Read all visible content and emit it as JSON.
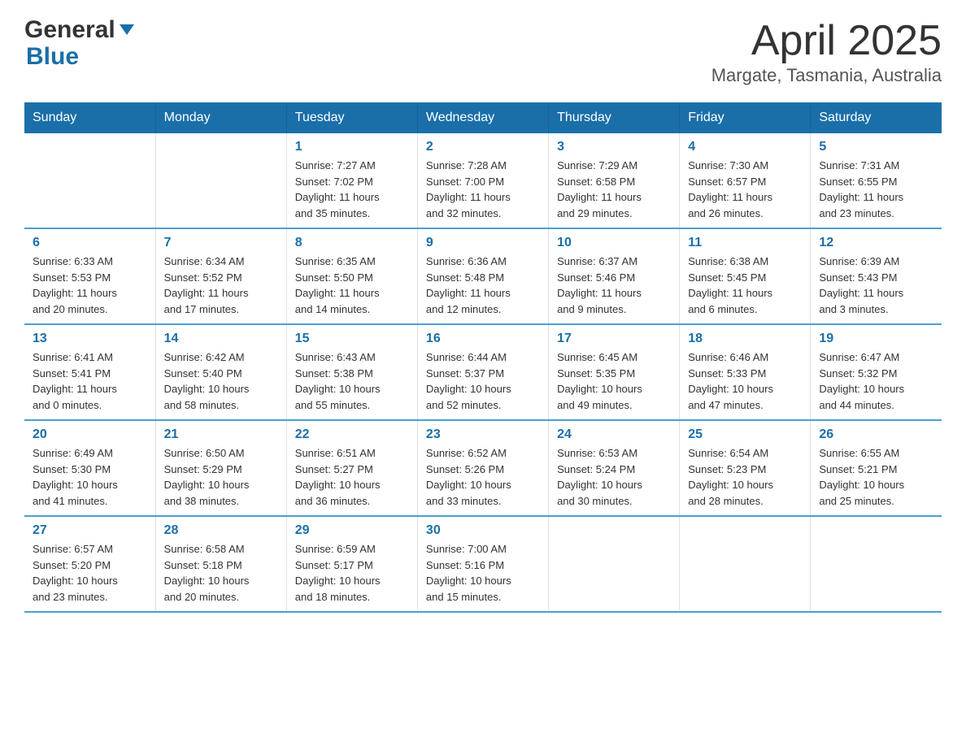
{
  "header": {
    "logo_general": "General",
    "logo_blue": "Blue",
    "title": "April 2025",
    "subtitle": "Margate, Tasmania, Australia"
  },
  "calendar": {
    "days_of_week": [
      "Sunday",
      "Monday",
      "Tuesday",
      "Wednesday",
      "Thursday",
      "Friday",
      "Saturday"
    ],
    "weeks": [
      [
        {
          "day": "",
          "info": ""
        },
        {
          "day": "",
          "info": ""
        },
        {
          "day": "1",
          "info": "Sunrise: 7:27 AM\nSunset: 7:02 PM\nDaylight: 11 hours\nand 35 minutes."
        },
        {
          "day": "2",
          "info": "Sunrise: 7:28 AM\nSunset: 7:00 PM\nDaylight: 11 hours\nand 32 minutes."
        },
        {
          "day": "3",
          "info": "Sunrise: 7:29 AM\nSunset: 6:58 PM\nDaylight: 11 hours\nand 29 minutes."
        },
        {
          "day": "4",
          "info": "Sunrise: 7:30 AM\nSunset: 6:57 PM\nDaylight: 11 hours\nand 26 minutes."
        },
        {
          "day": "5",
          "info": "Sunrise: 7:31 AM\nSunset: 6:55 PM\nDaylight: 11 hours\nand 23 minutes."
        }
      ],
      [
        {
          "day": "6",
          "info": "Sunrise: 6:33 AM\nSunset: 5:53 PM\nDaylight: 11 hours\nand 20 minutes."
        },
        {
          "day": "7",
          "info": "Sunrise: 6:34 AM\nSunset: 5:52 PM\nDaylight: 11 hours\nand 17 minutes."
        },
        {
          "day": "8",
          "info": "Sunrise: 6:35 AM\nSunset: 5:50 PM\nDaylight: 11 hours\nand 14 minutes."
        },
        {
          "day": "9",
          "info": "Sunrise: 6:36 AM\nSunset: 5:48 PM\nDaylight: 11 hours\nand 12 minutes."
        },
        {
          "day": "10",
          "info": "Sunrise: 6:37 AM\nSunset: 5:46 PM\nDaylight: 11 hours\nand 9 minutes."
        },
        {
          "day": "11",
          "info": "Sunrise: 6:38 AM\nSunset: 5:45 PM\nDaylight: 11 hours\nand 6 minutes."
        },
        {
          "day": "12",
          "info": "Sunrise: 6:39 AM\nSunset: 5:43 PM\nDaylight: 11 hours\nand 3 minutes."
        }
      ],
      [
        {
          "day": "13",
          "info": "Sunrise: 6:41 AM\nSunset: 5:41 PM\nDaylight: 11 hours\nand 0 minutes."
        },
        {
          "day": "14",
          "info": "Sunrise: 6:42 AM\nSunset: 5:40 PM\nDaylight: 10 hours\nand 58 minutes."
        },
        {
          "day": "15",
          "info": "Sunrise: 6:43 AM\nSunset: 5:38 PM\nDaylight: 10 hours\nand 55 minutes."
        },
        {
          "day": "16",
          "info": "Sunrise: 6:44 AM\nSunset: 5:37 PM\nDaylight: 10 hours\nand 52 minutes."
        },
        {
          "day": "17",
          "info": "Sunrise: 6:45 AM\nSunset: 5:35 PM\nDaylight: 10 hours\nand 49 minutes."
        },
        {
          "day": "18",
          "info": "Sunrise: 6:46 AM\nSunset: 5:33 PM\nDaylight: 10 hours\nand 47 minutes."
        },
        {
          "day": "19",
          "info": "Sunrise: 6:47 AM\nSunset: 5:32 PM\nDaylight: 10 hours\nand 44 minutes."
        }
      ],
      [
        {
          "day": "20",
          "info": "Sunrise: 6:49 AM\nSunset: 5:30 PM\nDaylight: 10 hours\nand 41 minutes."
        },
        {
          "day": "21",
          "info": "Sunrise: 6:50 AM\nSunset: 5:29 PM\nDaylight: 10 hours\nand 38 minutes."
        },
        {
          "day": "22",
          "info": "Sunrise: 6:51 AM\nSunset: 5:27 PM\nDaylight: 10 hours\nand 36 minutes."
        },
        {
          "day": "23",
          "info": "Sunrise: 6:52 AM\nSunset: 5:26 PM\nDaylight: 10 hours\nand 33 minutes."
        },
        {
          "day": "24",
          "info": "Sunrise: 6:53 AM\nSunset: 5:24 PM\nDaylight: 10 hours\nand 30 minutes."
        },
        {
          "day": "25",
          "info": "Sunrise: 6:54 AM\nSunset: 5:23 PM\nDaylight: 10 hours\nand 28 minutes."
        },
        {
          "day": "26",
          "info": "Sunrise: 6:55 AM\nSunset: 5:21 PM\nDaylight: 10 hours\nand 25 minutes."
        }
      ],
      [
        {
          "day": "27",
          "info": "Sunrise: 6:57 AM\nSunset: 5:20 PM\nDaylight: 10 hours\nand 23 minutes."
        },
        {
          "day": "28",
          "info": "Sunrise: 6:58 AM\nSunset: 5:18 PM\nDaylight: 10 hours\nand 20 minutes."
        },
        {
          "day": "29",
          "info": "Sunrise: 6:59 AM\nSunset: 5:17 PM\nDaylight: 10 hours\nand 18 minutes."
        },
        {
          "day": "30",
          "info": "Sunrise: 7:00 AM\nSunset: 5:16 PM\nDaylight: 10 hours\nand 15 minutes."
        },
        {
          "day": "",
          "info": ""
        },
        {
          "day": "",
          "info": ""
        },
        {
          "day": "",
          "info": ""
        }
      ]
    ]
  }
}
